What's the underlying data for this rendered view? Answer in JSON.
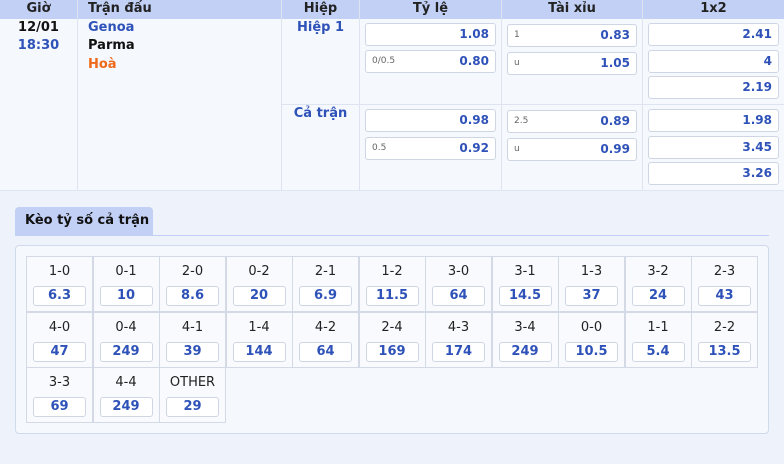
{
  "headers": {
    "time": "Giờ",
    "match": "Trận đấu",
    "period": "Hiệp",
    "handicap": "Tỷ lệ",
    "over_under": "Tài xỉu",
    "one_x_two": "1x2"
  },
  "match": {
    "date": "12/01",
    "time": "18:30",
    "home": "Genoa",
    "away": "Parma",
    "draw": "Hoà"
  },
  "first_half": {
    "label": "Hiệp 1",
    "handicap": [
      {
        "line": "",
        "odds": "1.08"
      },
      {
        "line": "0/0.5",
        "odds": "0.80"
      }
    ],
    "over_under": [
      {
        "line": "1",
        "odds": "0.83"
      },
      {
        "line": "u",
        "odds": "1.05"
      }
    ],
    "one_x_two": [
      "2.41",
      "4",
      "2.19"
    ]
  },
  "full_time": {
    "label": "Cả trận",
    "handicap": [
      {
        "line": "",
        "odds": "0.98"
      },
      {
        "line": "0.5",
        "odds": "0.92"
      }
    ],
    "over_under": [
      {
        "line": "2.5",
        "odds": "0.89"
      },
      {
        "line": "u",
        "odds": "0.99"
      }
    ],
    "one_x_two": [
      "1.98",
      "3.45",
      "3.26"
    ]
  },
  "score_section": {
    "tab_label": "Kèo tỷ số cả trận",
    "scores": [
      {
        "score": "1-0",
        "odds": "6.3"
      },
      {
        "score": "0-1",
        "odds": "10"
      },
      {
        "score": "2-0",
        "odds": "8.6"
      },
      {
        "score": "0-2",
        "odds": "20"
      },
      {
        "score": "2-1",
        "odds": "6.9"
      },
      {
        "score": "1-2",
        "odds": "11.5"
      },
      {
        "score": "3-0",
        "odds": "64"
      },
      {
        "score": "3-1",
        "odds": "14.5"
      },
      {
        "score": "1-3",
        "odds": "37"
      },
      {
        "score": "3-2",
        "odds": "24"
      },
      {
        "score": "2-3",
        "odds": "43"
      },
      {
        "score": "4-0",
        "odds": "47"
      },
      {
        "score": "0-4",
        "odds": "249"
      },
      {
        "score": "4-1",
        "odds": "39"
      },
      {
        "score": "1-4",
        "odds": "144"
      },
      {
        "score": "4-2",
        "odds": "64"
      },
      {
        "score": "2-4",
        "odds": "169"
      },
      {
        "score": "4-3",
        "odds": "174"
      },
      {
        "score": "3-4",
        "odds": "249"
      },
      {
        "score": "0-0",
        "odds": "10.5"
      },
      {
        "score": "1-1",
        "odds": "5.4"
      },
      {
        "score": "2-2",
        "odds": "13.5"
      },
      {
        "score": "3-3",
        "odds": "69"
      },
      {
        "score": "4-4",
        "odds": "249"
      },
      {
        "score": "OTHER",
        "odds": "29"
      }
    ]
  }
}
